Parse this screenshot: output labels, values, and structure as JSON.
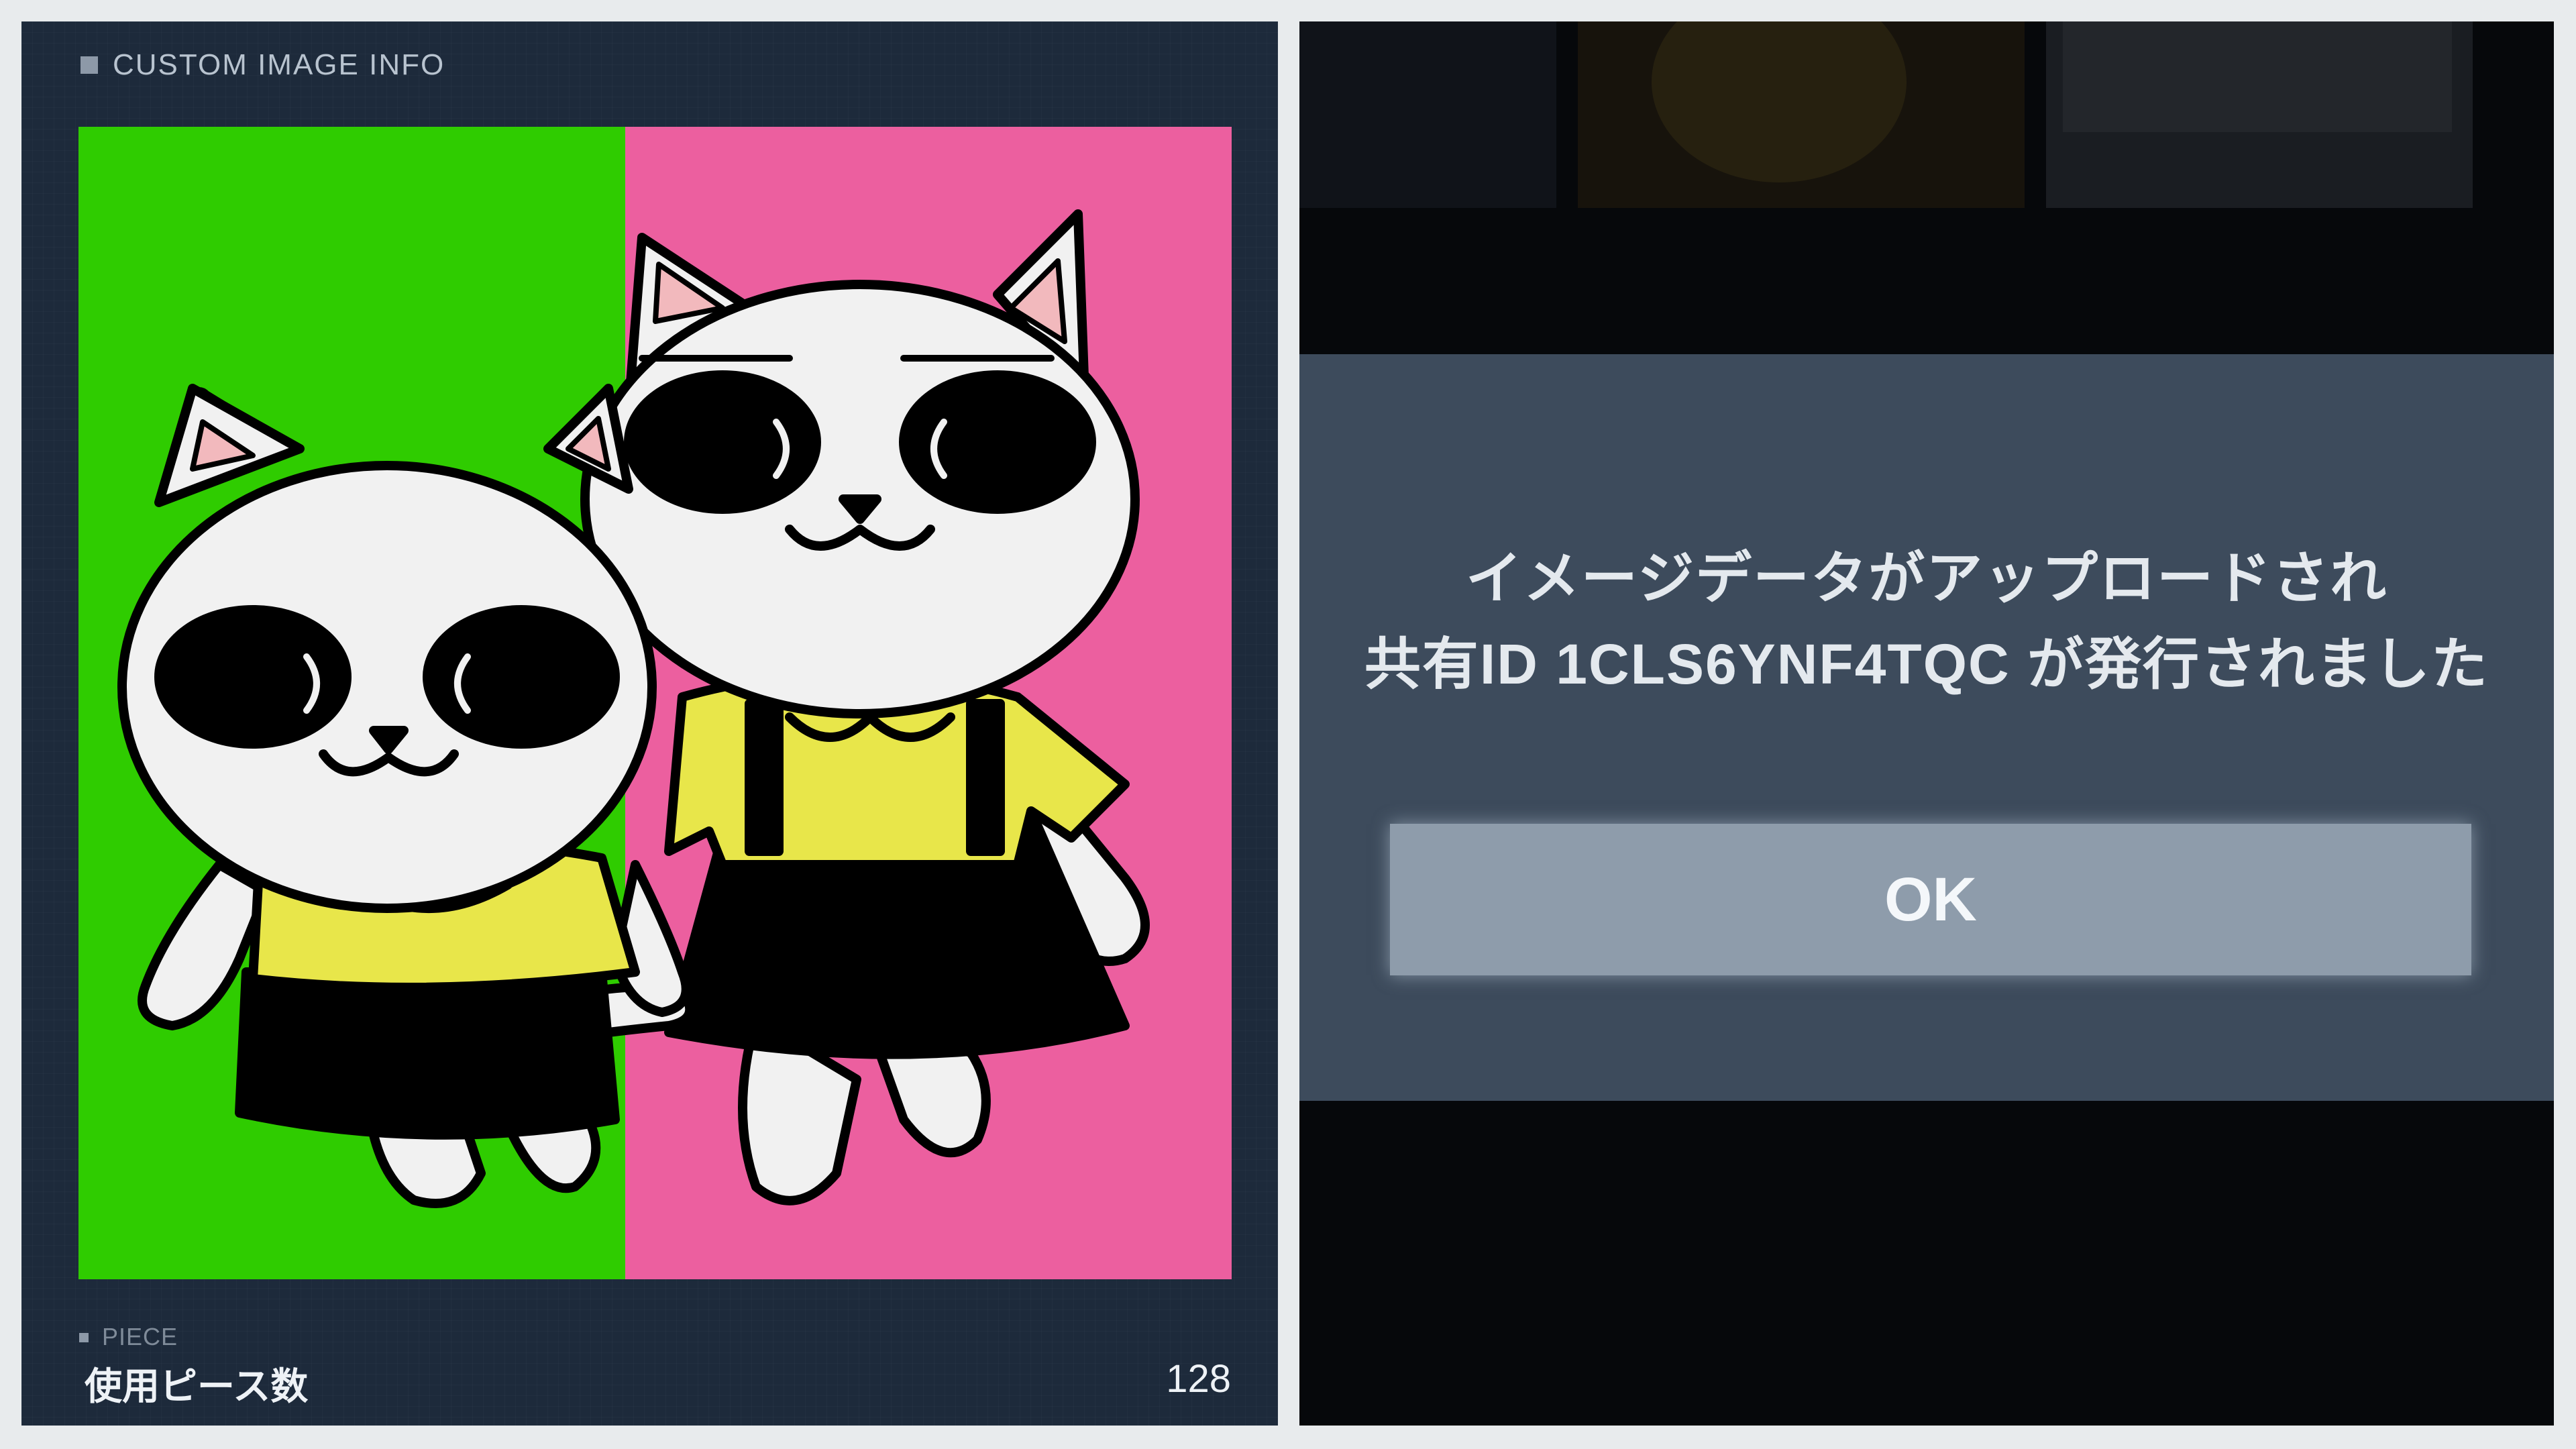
{
  "left_panel": {
    "header_title": "CUSTOM IMAGE INFO",
    "piece": {
      "section_label": "PIECE",
      "name": "使用ピース数",
      "count": "128"
    },
    "artwork_colors": {
      "left_background": "#2fcc00",
      "right_background": "#ec5f9f",
      "shirt": "#e8e64a",
      "skirt": "#000000",
      "cat_body": "#f1f1f1",
      "ear_inner": "#f2b9bd"
    }
  },
  "right_panel": {
    "dialog": {
      "message_line1": "イメージデータがアップロードされ",
      "message_line2": "共有ID 1CLS6YNF4TQC が発行されました",
      "ok_label": "OK"
    }
  }
}
